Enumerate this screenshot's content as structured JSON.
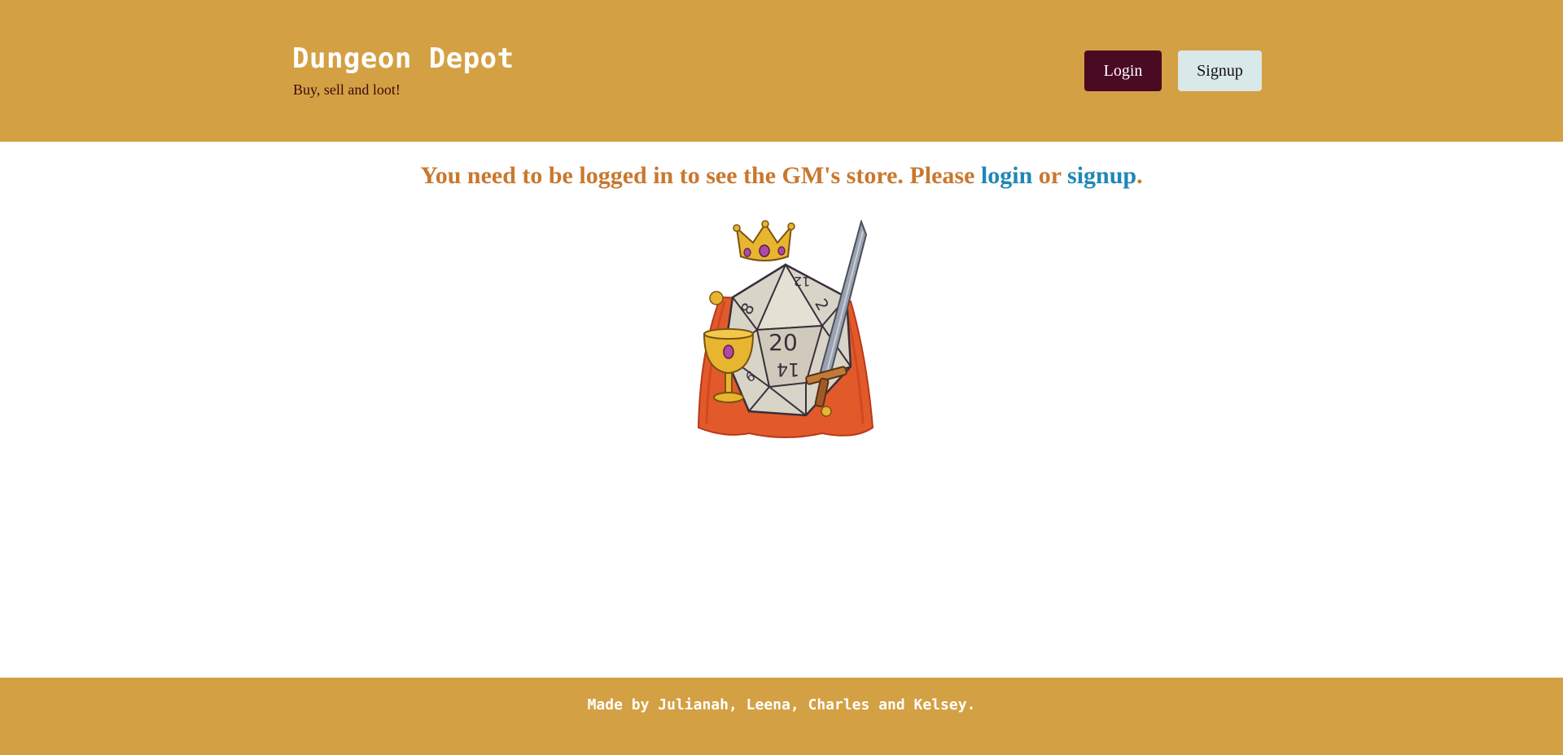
{
  "header": {
    "title": "Dungeon Depot",
    "tagline": "Buy, sell and loot!",
    "login_label": "Login",
    "signup_label": "Signup"
  },
  "notice": {
    "prefix": "You need to be logged in to see the GM's store. Please ",
    "login_link": "login",
    "middle": " or ",
    "signup_link": "signup",
    "suffix": "."
  },
  "mascot": {
    "d20_top_number": "12",
    "d20_center_number": "20",
    "d20_left_number": "8",
    "d20_right_number": "2",
    "d20_bottom_number": "14",
    "d20_lower_left_number": "6",
    "icon": "crowned-d20-mascot"
  },
  "footer": {
    "credits": "Made by Julianah, Leena, Charles and Kelsey."
  },
  "colors": {
    "header_bg": "#d4a044",
    "login_button_bg": "#4a0a22",
    "signup_button_bg": "#d9e8e8",
    "notice_text": "#c9782e",
    "link": "#1f87b6"
  }
}
